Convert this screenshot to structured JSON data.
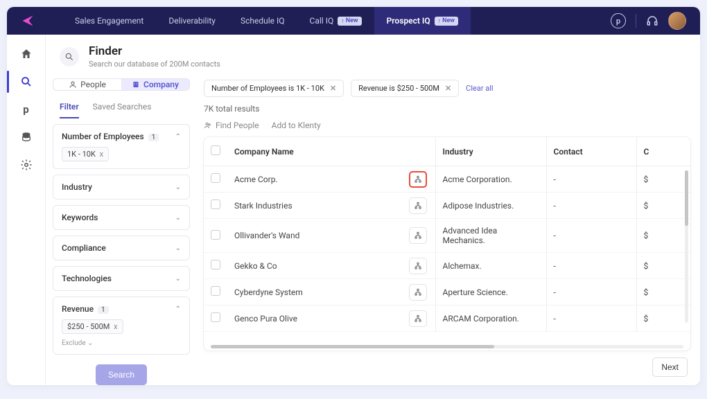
{
  "topnav": {
    "items": [
      "Sales Engagement",
      "Deliverability",
      "Schedule IQ",
      "Call IQ",
      "Prospect IQ"
    ],
    "new_badge": "New"
  },
  "header": {
    "title": "Finder",
    "subtitle": "Search our database of 200M contacts"
  },
  "entity_tabs": {
    "people": "People",
    "company": "Company"
  },
  "subtabs": {
    "filter": "Filter",
    "saved": "Saved Searches"
  },
  "filters": {
    "employees": {
      "label": "Number of Employees",
      "count": "1",
      "chip": "1K - 10K"
    },
    "industry": {
      "label": "Industry"
    },
    "keywords": {
      "label": "Keywords"
    },
    "compliance": {
      "label": "Compliance"
    },
    "technologies": {
      "label": "Technologies"
    },
    "revenue": {
      "label": "Revenue",
      "count": "1",
      "chip": "$250 - 500M"
    },
    "exclude": "Exclude",
    "search_btn": "Search"
  },
  "active_filters": {
    "chip1": "Number of Employees is 1K - 10K",
    "chip2": "Revenue is $250 - 500M",
    "clear": "Clear all"
  },
  "results": {
    "total": "7K total results",
    "find_people": "Find People",
    "add_klenty": "Add to Klenty"
  },
  "columns": {
    "company": "Company Name",
    "industry": "Industry",
    "contact": "Contact",
    "last": "C"
  },
  "rows": [
    {
      "name": "Acme Corp.",
      "industry": "Acme Corporation.",
      "contact": "-",
      "last": "$",
      "hl": true
    },
    {
      "name": "Stark Industries",
      "industry": "Adipose Industries.",
      "contact": "-",
      "last": "$"
    },
    {
      "name": "Ollivander's Wand",
      "industry": "Advanced Idea Mechanics.",
      "contact": "-",
      "last": "$"
    },
    {
      "name": "Gekko & Co",
      "industry": "Alchemax.",
      "contact": "-",
      "last": "$"
    },
    {
      "name": "Cyberdyne System",
      "industry": "Aperture Science.",
      "contact": "-",
      "last": "$"
    },
    {
      "name": "Genco Pura Olive",
      "industry": "ARCAM Corporation.",
      "contact": "-",
      "last": "$"
    }
  ],
  "footer": {
    "next": "Next"
  }
}
